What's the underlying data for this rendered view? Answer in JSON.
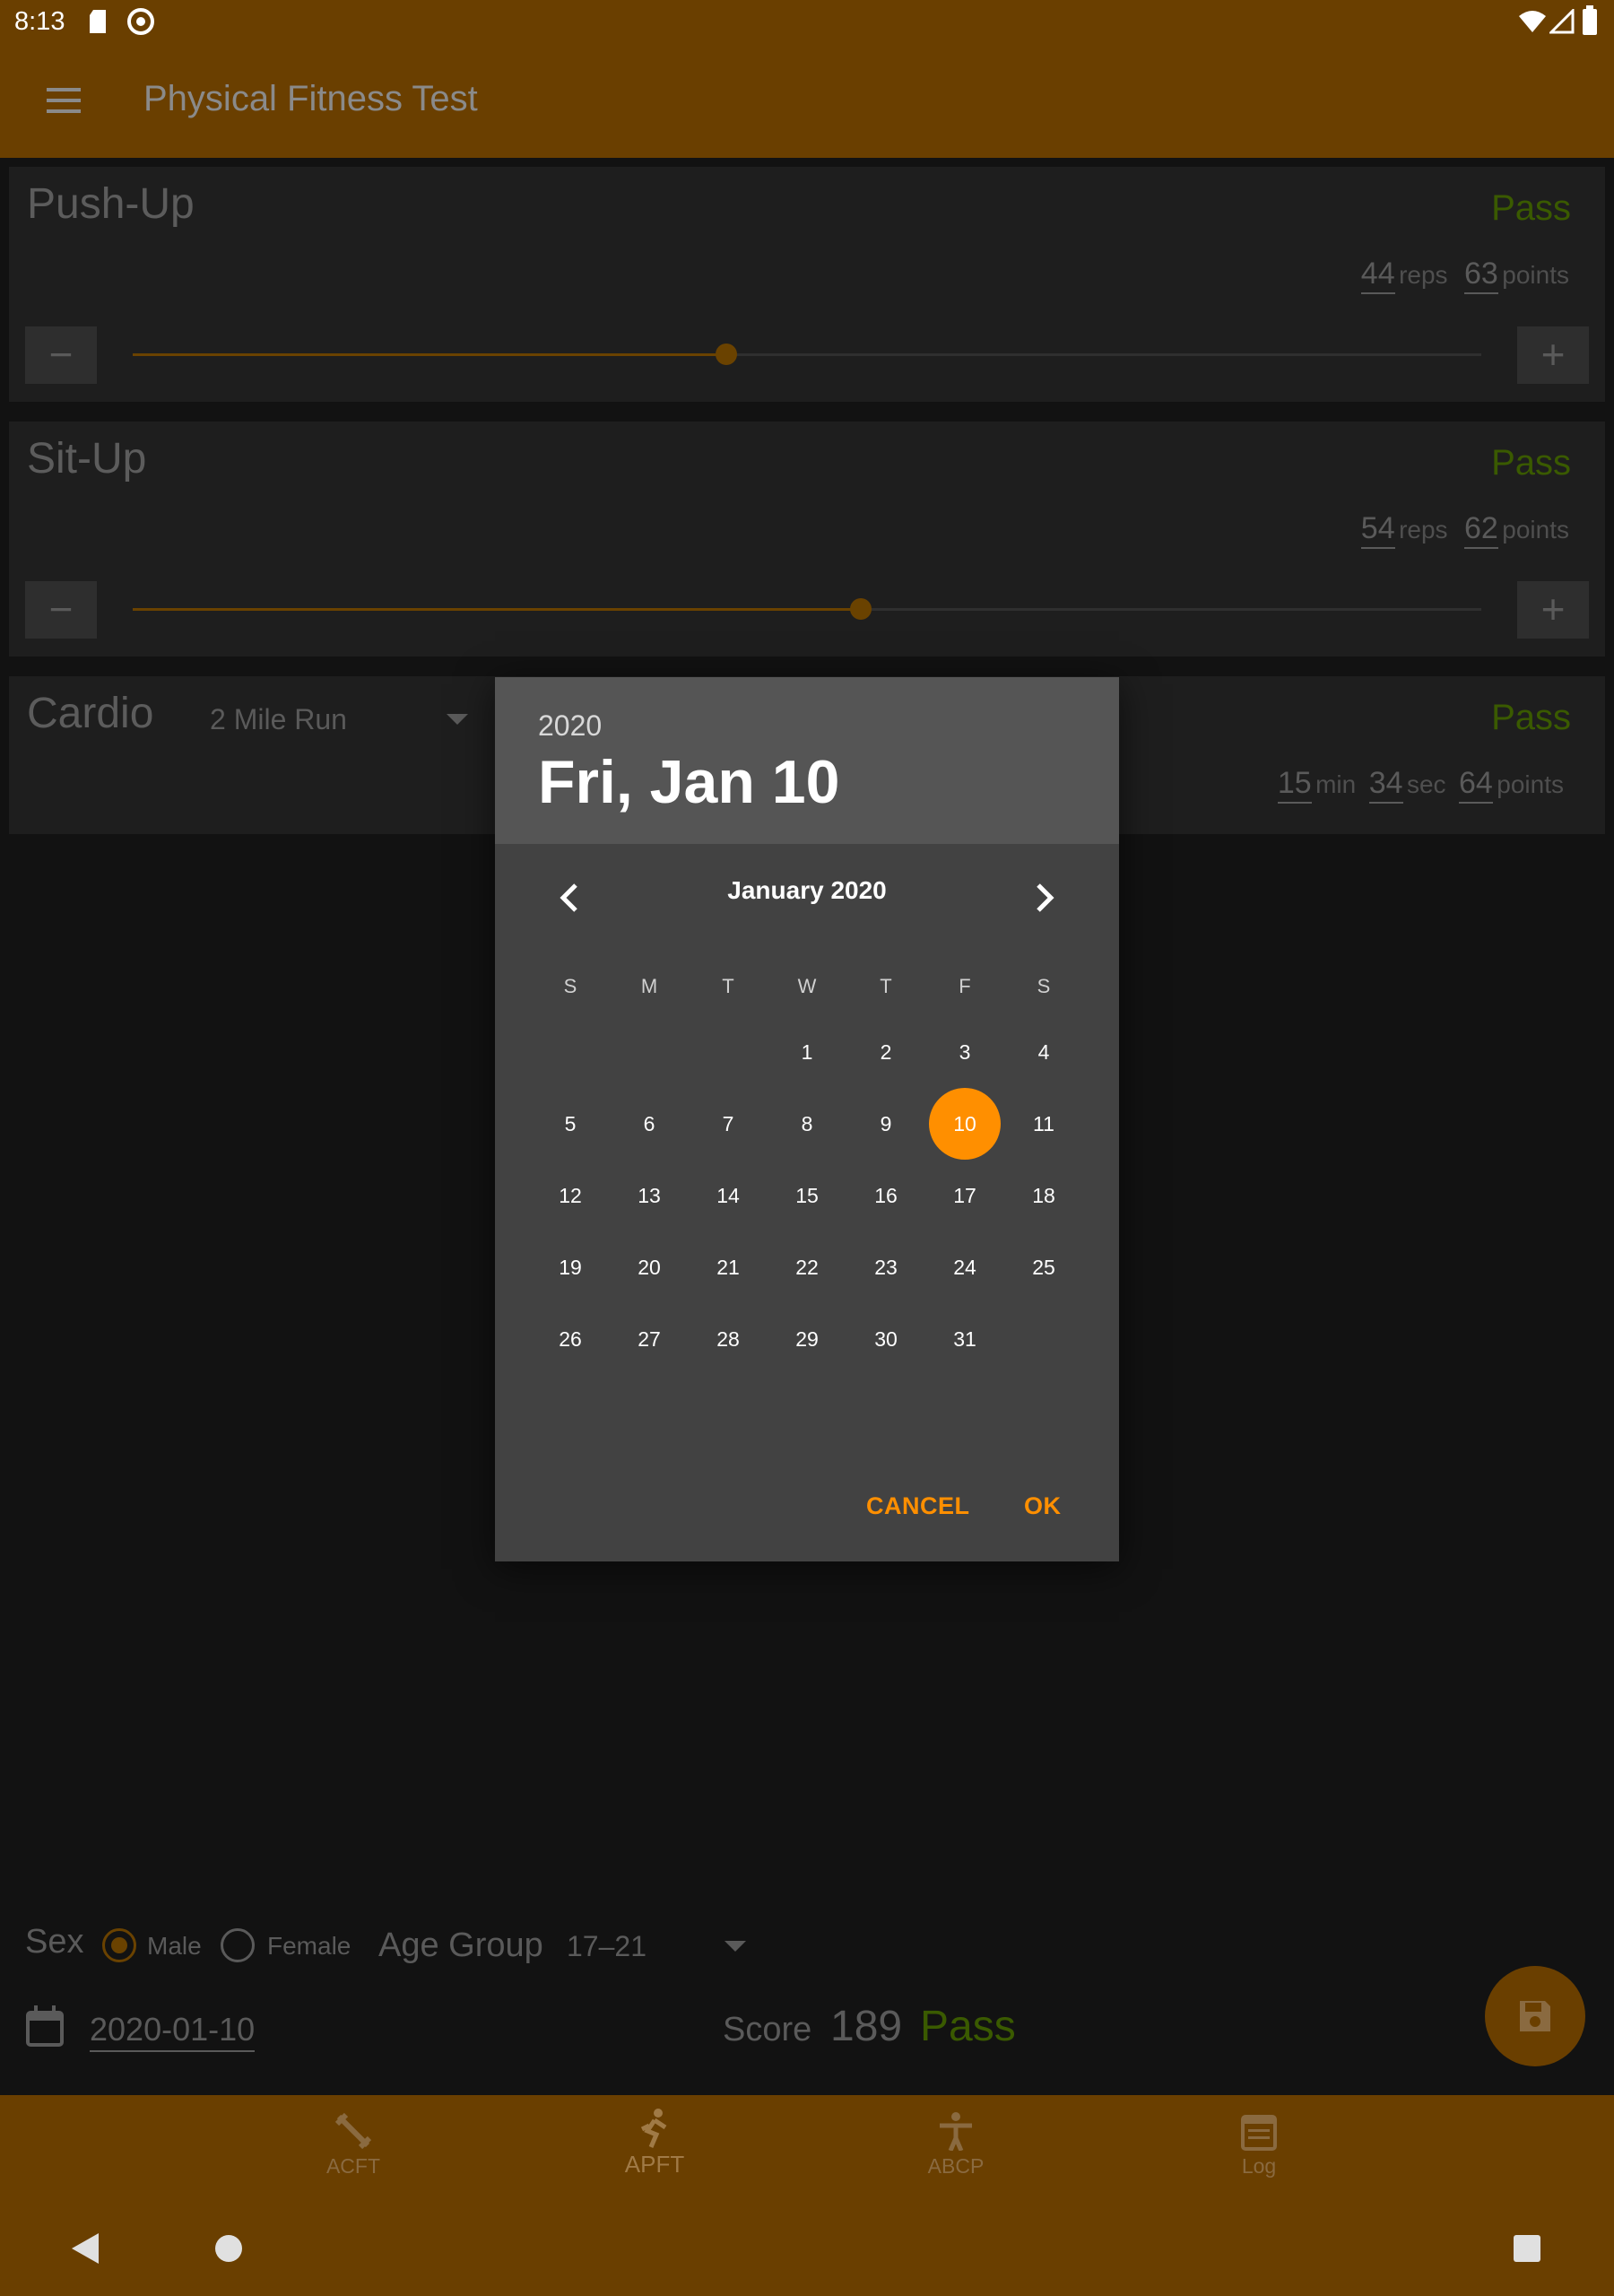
{
  "status": {
    "time": "8:13"
  },
  "app": {
    "title": "Physical Fitness Test"
  },
  "pushup": {
    "title": "Push-Up",
    "result": "Pass",
    "reps": "44",
    "reps_unit": "reps",
    "points": "63",
    "points_unit": "points",
    "level": 0.44,
    "minus": "−",
    "plus": "+"
  },
  "situp": {
    "title": "Sit-Up",
    "result": "Pass",
    "reps": "54",
    "reps_unit": "reps",
    "points": "62",
    "points_unit": "points",
    "level": 0.54,
    "minus": "−",
    "plus": "+"
  },
  "cardio": {
    "title": "Cardio",
    "event": "2 Mile Run",
    "result": "Pass",
    "min": "15",
    "min_unit": "min",
    "sec": "34",
    "sec_unit": "sec",
    "points": "64",
    "points_unit": "points"
  },
  "dialog": {
    "year": "2020",
    "selected_date": "Fri, Jan 10",
    "month_label": "January 2020",
    "weekdays": [
      "S",
      "M",
      "T",
      "W",
      "T",
      "F",
      "S"
    ],
    "days": [
      "1",
      "2",
      "3",
      "4",
      "5",
      "6",
      "7",
      "8",
      "9",
      "10",
      "11",
      "12",
      "13",
      "14",
      "15",
      "16",
      "17",
      "18",
      "19",
      "20",
      "21",
      "22",
      "23",
      "24",
      "25",
      "26",
      "27",
      "28",
      "29",
      "30",
      "31"
    ],
    "first_weekday": 3,
    "selected_day": "10",
    "cancel": "CANCEL",
    "ok": "OK"
  },
  "profile": {
    "sex_label": "Sex",
    "male": "Male",
    "female": "Female",
    "sex_selected": "Male",
    "age_label": "Age Group",
    "age_value": "17–21",
    "date": "2020-01-10",
    "score_label": "Score",
    "score": "189",
    "score_result": "Pass"
  },
  "bottom_nav": [
    {
      "label": "ACFT",
      "icon": "dumbbell-icon"
    },
    {
      "label": "APFT",
      "icon": "runner-icon"
    },
    {
      "label": "ABCP",
      "icon": "body-icon"
    },
    {
      "label": "Log",
      "icon": "calendar-log-icon"
    }
  ],
  "colors": {
    "accent": "#ff8f00",
    "primary_dark": "#6a3f00",
    "pass_green": "#3a5a00"
  }
}
